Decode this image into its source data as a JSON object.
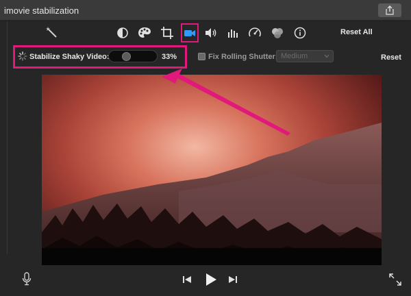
{
  "window": {
    "title": "imovie stabilization"
  },
  "toolbar": {
    "tools": [
      {
        "name": "magic-wand-icon"
      },
      {
        "name": "color-balance-icon"
      },
      {
        "name": "color-palette-icon"
      },
      {
        "name": "crop-icon"
      },
      {
        "name": "video-camera-icon",
        "active": true
      },
      {
        "name": "volume-icon"
      },
      {
        "name": "equalizer-icon"
      },
      {
        "name": "speedometer-icon"
      },
      {
        "name": "filter-icon"
      },
      {
        "name": "info-icon"
      }
    ],
    "reset_all_label": "Reset All"
  },
  "stabilization": {
    "label": "Stabilize Shaky Video:",
    "value": "33%",
    "level": 0.33,
    "fix_rolling_shutter_label": "Fix Rolling Shutter:",
    "fix_rolling_shutter_checked": false,
    "rolling_shutter_value": "Medium",
    "reset_label": "Reset"
  },
  "colors": {
    "highlight": "#e0197a",
    "panel": "#262626",
    "titlebar": "#3a3a3a"
  }
}
